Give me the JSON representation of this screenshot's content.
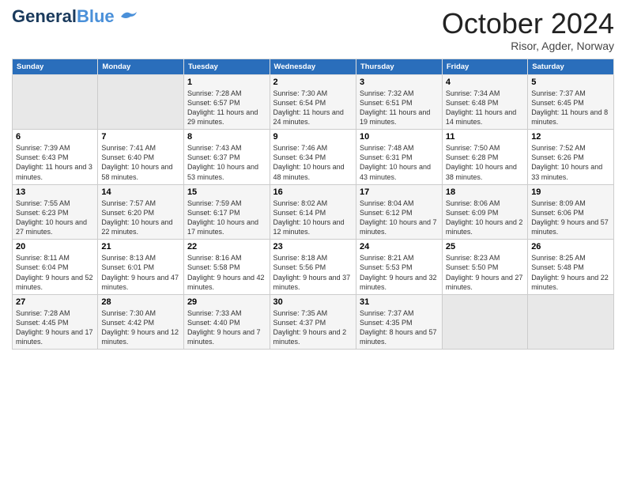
{
  "header": {
    "logo_general": "General",
    "logo_blue": "Blue",
    "month_title": "October 2024",
    "location": "Risor, Agder, Norway"
  },
  "days_of_week": [
    "Sunday",
    "Monday",
    "Tuesday",
    "Wednesday",
    "Thursday",
    "Friday",
    "Saturday"
  ],
  "weeks": [
    [
      {
        "day": "",
        "empty": true
      },
      {
        "day": "",
        "empty": true
      },
      {
        "day": "1",
        "sunrise": "7:28 AM",
        "sunset": "6:57 PM",
        "daylight": "11 hours and 29 minutes."
      },
      {
        "day": "2",
        "sunrise": "7:30 AM",
        "sunset": "6:54 PM",
        "daylight": "11 hours and 24 minutes."
      },
      {
        "day": "3",
        "sunrise": "7:32 AM",
        "sunset": "6:51 PM",
        "daylight": "11 hours and 19 minutes."
      },
      {
        "day": "4",
        "sunrise": "7:34 AM",
        "sunset": "6:48 PM",
        "daylight": "11 hours and 14 minutes."
      },
      {
        "day": "5",
        "sunrise": "7:37 AM",
        "sunset": "6:45 PM",
        "daylight": "11 hours and 8 minutes."
      }
    ],
    [
      {
        "day": "6",
        "sunrise": "7:39 AM",
        "sunset": "6:43 PM",
        "daylight": "11 hours and 3 minutes."
      },
      {
        "day": "7",
        "sunrise": "7:41 AM",
        "sunset": "6:40 PM",
        "daylight": "10 hours and 58 minutes."
      },
      {
        "day": "8",
        "sunrise": "7:43 AM",
        "sunset": "6:37 PM",
        "daylight": "10 hours and 53 minutes."
      },
      {
        "day": "9",
        "sunrise": "7:46 AM",
        "sunset": "6:34 PM",
        "daylight": "10 hours and 48 minutes."
      },
      {
        "day": "10",
        "sunrise": "7:48 AM",
        "sunset": "6:31 PM",
        "daylight": "10 hours and 43 minutes."
      },
      {
        "day": "11",
        "sunrise": "7:50 AM",
        "sunset": "6:28 PM",
        "daylight": "10 hours and 38 minutes."
      },
      {
        "day": "12",
        "sunrise": "7:52 AM",
        "sunset": "6:26 PM",
        "daylight": "10 hours and 33 minutes."
      }
    ],
    [
      {
        "day": "13",
        "sunrise": "7:55 AM",
        "sunset": "6:23 PM",
        "daylight": "10 hours and 27 minutes."
      },
      {
        "day": "14",
        "sunrise": "7:57 AM",
        "sunset": "6:20 PM",
        "daylight": "10 hours and 22 minutes."
      },
      {
        "day": "15",
        "sunrise": "7:59 AM",
        "sunset": "6:17 PM",
        "daylight": "10 hours and 17 minutes."
      },
      {
        "day": "16",
        "sunrise": "8:02 AM",
        "sunset": "6:14 PM",
        "daylight": "10 hours and 12 minutes."
      },
      {
        "day": "17",
        "sunrise": "8:04 AM",
        "sunset": "6:12 PM",
        "daylight": "10 hours and 7 minutes."
      },
      {
        "day": "18",
        "sunrise": "8:06 AM",
        "sunset": "6:09 PM",
        "daylight": "10 hours and 2 minutes."
      },
      {
        "day": "19",
        "sunrise": "8:09 AM",
        "sunset": "6:06 PM",
        "daylight": "9 hours and 57 minutes."
      }
    ],
    [
      {
        "day": "20",
        "sunrise": "8:11 AM",
        "sunset": "6:04 PM",
        "daylight": "9 hours and 52 minutes."
      },
      {
        "day": "21",
        "sunrise": "8:13 AM",
        "sunset": "6:01 PM",
        "daylight": "9 hours and 47 minutes."
      },
      {
        "day": "22",
        "sunrise": "8:16 AM",
        "sunset": "5:58 PM",
        "daylight": "9 hours and 42 minutes."
      },
      {
        "day": "23",
        "sunrise": "8:18 AM",
        "sunset": "5:56 PM",
        "daylight": "9 hours and 37 minutes."
      },
      {
        "day": "24",
        "sunrise": "8:21 AM",
        "sunset": "5:53 PM",
        "daylight": "9 hours and 32 minutes."
      },
      {
        "day": "25",
        "sunrise": "8:23 AM",
        "sunset": "5:50 PM",
        "daylight": "9 hours and 27 minutes."
      },
      {
        "day": "26",
        "sunrise": "8:25 AM",
        "sunset": "5:48 PM",
        "daylight": "9 hours and 22 minutes."
      }
    ],
    [
      {
        "day": "27",
        "sunrise": "7:28 AM",
        "sunset": "4:45 PM",
        "daylight": "9 hours and 17 minutes."
      },
      {
        "day": "28",
        "sunrise": "7:30 AM",
        "sunset": "4:42 PM",
        "daylight": "9 hours and 12 minutes."
      },
      {
        "day": "29",
        "sunrise": "7:33 AM",
        "sunset": "4:40 PM",
        "daylight": "9 hours and 7 minutes."
      },
      {
        "day": "30",
        "sunrise": "7:35 AM",
        "sunset": "4:37 PM",
        "daylight": "9 hours and 2 minutes."
      },
      {
        "day": "31",
        "sunrise": "7:37 AM",
        "sunset": "4:35 PM",
        "daylight": "8 hours and 57 minutes."
      },
      {
        "day": "",
        "empty": true
      },
      {
        "day": "",
        "empty": true
      }
    ]
  ]
}
